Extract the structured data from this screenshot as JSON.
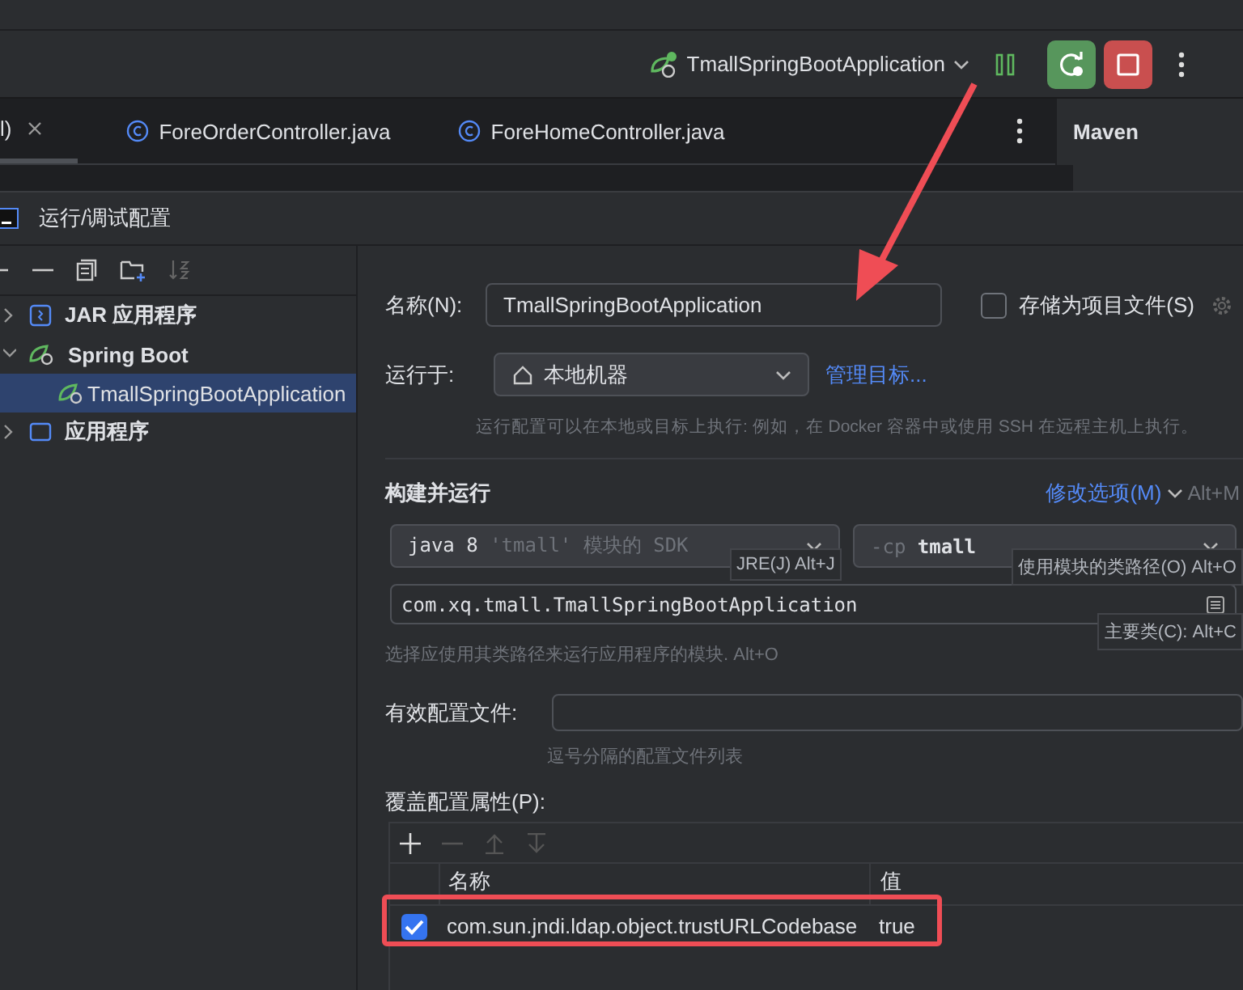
{
  "toolbar": {
    "run_config": "TmallSpringBootApplication"
  },
  "editor_tabs": [
    {
      "label": "l)",
      "closable": true,
      "selected": true
    },
    {
      "label": "ForeOrderController.java",
      "closable": false,
      "selected": false
    },
    {
      "label": "ForeHomeController.java",
      "closable": false,
      "selected": false
    }
  ],
  "side_panel": {
    "title": "Maven"
  },
  "dialog": {
    "title": "运行/调试配置",
    "tree": [
      {
        "label": "JAR 应用程序",
        "kind": "jar",
        "expanded": false,
        "selected": false,
        "bold": true
      },
      {
        "label": "Spring Boot",
        "kind": "spring",
        "expanded": true,
        "selected": false,
        "bold": true,
        "children": [
          {
            "label": "TmallSpringBootApplication",
            "kind": "spring",
            "selected": true,
            "bold": false
          }
        ]
      },
      {
        "label": "应用程序",
        "kind": "app",
        "expanded": false,
        "selected": false,
        "bold": true
      }
    ],
    "name_label": "名称(N):",
    "name_value": "TmallSpringBootApplication",
    "store_label": "存储为项目文件(S)",
    "store_checked": false,
    "run_on_label": "运行于:",
    "run_on_value": "本地机器",
    "manage_link": "管理目标...",
    "run_on_hint": "运行配置可以在本地或目标上执行: 例如，在 Docker 容器中或使用 SSH 在远程主机上执行。",
    "build_title": "构建并运行",
    "modify_link": "修改选项(M)",
    "modify_shortcut": "Alt+M",
    "sdk_value": [
      {
        "text": "java 8 ",
        "dim": false
      },
      {
        "text": "'tmall' 模块的 SDK",
        "dim": true
      }
    ],
    "cp_value": [
      {
        "text": "-cp ",
        "dim": true
      },
      {
        "text": "tmall",
        "dim": false
      }
    ],
    "main_class": "com.xq.tmall.TmallSpringBootApplication",
    "module_hint": "选择应使用其类路径来运行应用程序的模块. Alt+O",
    "profiles_label": "有效配置文件:",
    "profiles_hint": "逗号分隔的配置文件列表",
    "override_label": "覆盖配置属性(P):",
    "columns": [
      "名称",
      "值"
    ],
    "rows": [
      {
        "checked": true,
        "name": "com.sun.jndi.ldap.object.trustURLCodebase",
        "value": "true"
      }
    ],
    "tooltips": [
      {
        "text": "JRE(J) Alt+J"
      },
      {
        "text": "使用模块的类路径(O) Alt+O"
      },
      {
        "text": "主要类(C): Alt+C"
      }
    ]
  }
}
